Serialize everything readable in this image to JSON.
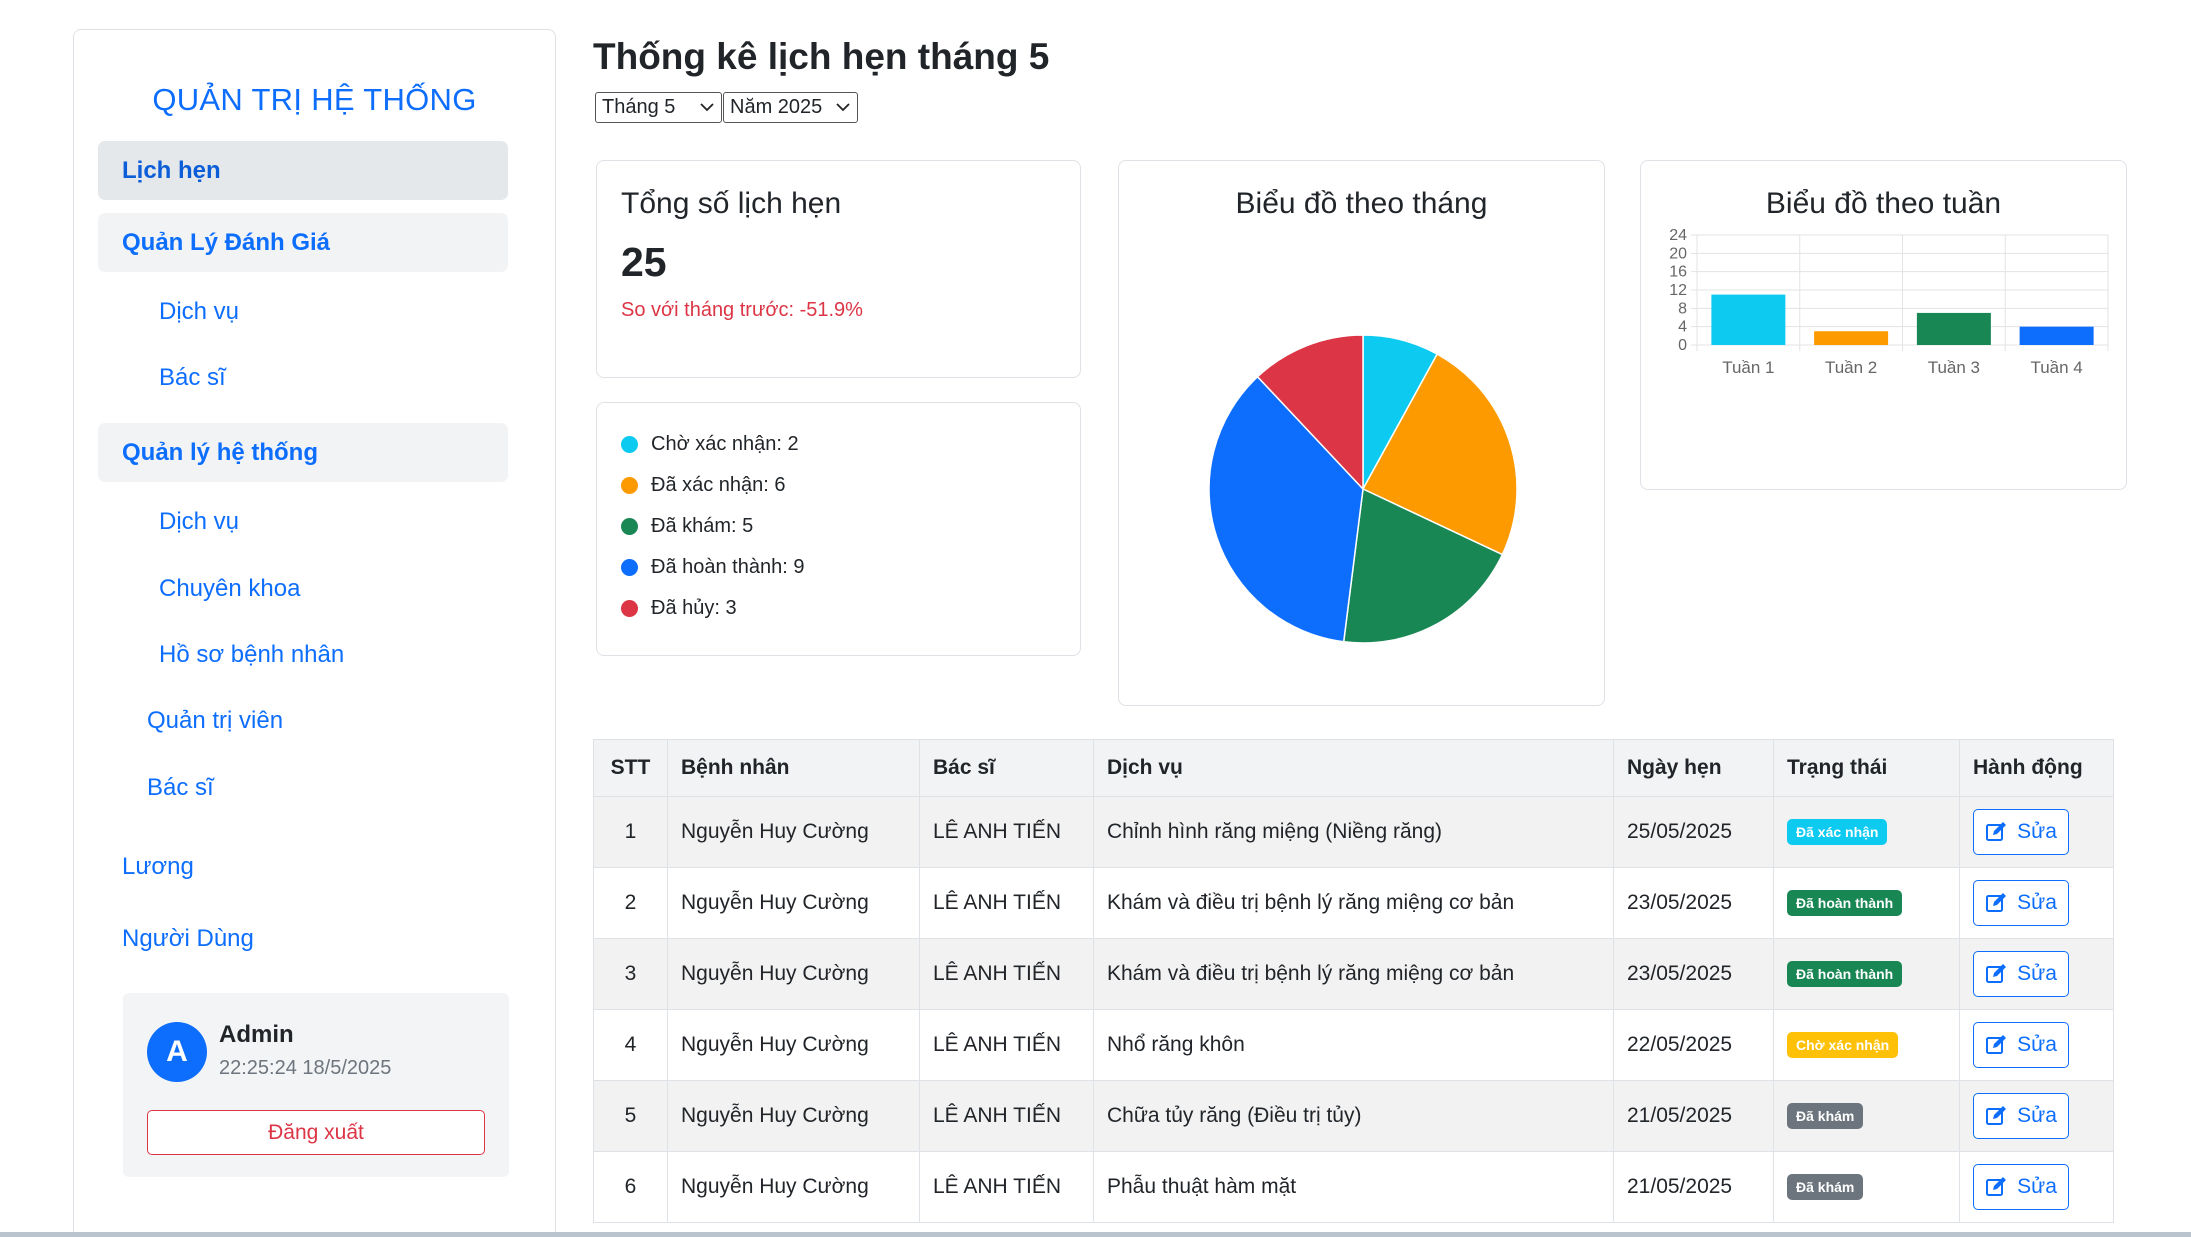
{
  "sidebar": {
    "title": "QUẢN TRỊ HỆ THỐNG",
    "appointments": "Lịch hẹn",
    "review_group": "Quản Lý Đánh Giá",
    "review_items": [
      "Dịch vụ",
      "Bác sĩ"
    ],
    "system_group": "Quản lý hệ thống",
    "system_items": [
      "Dịch vụ",
      "Chuyên khoa",
      "Hồ sơ bệnh nhân"
    ],
    "admin_link": "Quản trị viên",
    "doctor_link": "Bác sĩ",
    "salary": "Lương",
    "users": "Người Dùng"
  },
  "user": {
    "initial": "A",
    "name": "Admin",
    "time": "22:25:24 18/5/2025",
    "logout": "Đăng xuất"
  },
  "header": {
    "title": "Thống kê lịch hẹn tháng 5",
    "month": "Tháng 5",
    "year": "Năm 2025"
  },
  "summary": {
    "label": "Tổng số lịch hẹn",
    "total": "25",
    "compare": "So với tháng trước: -51.9%"
  },
  "status_legend": [
    {
      "text": "Chờ xác nhận: 2",
      "color": "#0dcaf0"
    },
    {
      "text": "Đã xác nhận: 6",
      "color": "#fd9a00"
    },
    {
      "text": "Đã khám: 5",
      "color": "#198754"
    },
    {
      "text": "Đã hoàn thành: 9",
      "color": "#0d6efd"
    },
    {
      "text": "Đã hủy: 3",
      "color": "#dc3545"
    }
  ],
  "charts": {
    "month_title": "Biểu đồ theo tháng",
    "week_title": "Biểu đồ theo tuần"
  },
  "chart_data": [
    {
      "type": "pie",
      "title": "Biểu đồ theo tháng",
      "categories": [
        "Chờ xác nhận",
        "Đã xác nhận",
        "Đã khám",
        "Đã hoàn thành",
        "Đã hủy"
      ],
      "values": [
        2,
        6,
        5,
        9,
        3
      ],
      "colors": [
        "#0dcaf0",
        "#fd9a00",
        "#198754",
        "#0d6efd",
        "#dc3545"
      ]
    },
    {
      "type": "bar",
      "title": "Biểu đồ theo tuần",
      "categories": [
        "Tuần 1",
        "Tuần 2",
        "Tuần 3",
        "Tuần 4"
      ],
      "values": [
        11,
        3,
        7,
        4
      ],
      "colors": [
        "#0dcaf0",
        "#fd9a00",
        "#198754",
        "#0d6efd"
      ],
      "ylim": [
        0,
        24
      ],
      "yticks": [
        0,
        4,
        8,
        12,
        16,
        20,
        24
      ],
      "grid": true
    }
  ],
  "table": {
    "headers": [
      "STT",
      "Bệnh nhân",
      "Bác sĩ",
      "Dịch vụ",
      "Ngày hẹn",
      "Trạng thái",
      "Hành động"
    ],
    "edit_label": "Sửa",
    "rows": [
      {
        "stt": "1",
        "patient": "Nguyễn Huy Cường",
        "doctor": "LÊ ANH TIẾN",
        "service": "Chỉnh hình răng miệng (Niềng răng)",
        "date": "25/05/2025",
        "status": "Đã xác nhận",
        "status_color": "#0dcaf0"
      },
      {
        "stt": "2",
        "patient": "Nguyễn Huy Cường",
        "doctor": "LÊ ANH TIẾN",
        "service": "Khám và điều trị bệnh lý răng miệng cơ bản",
        "date": "23/05/2025",
        "status": "Đã hoàn thành",
        "status_color": "#198754"
      },
      {
        "stt": "3",
        "patient": "Nguyễn Huy Cường",
        "doctor": "LÊ ANH TIẾN",
        "service": "Khám và điều trị bệnh lý răng miệng cơ bản",
        "date": "23/05/2025",
        "status": "Đã hoàn thành",
        "status_color": "#198754"
      },
      {
        "stt": "4",
        "patient": "Nguyễn Huy Cường",
        "doctor": "LÊ ANH TIẾN",
        "service": "Nhổ răng khôn",
        "date": "22/05/2025",
        "status": "Chờ xác nhận",
        "status_color": "#ffc107"
      },
      {
        "stt": "5",
        "patient": "Nguyễn Huy Cường",
        "doctor": "LÊ ANH TIẾN",
        "service": "Chữa tủy răng (Điều trị tủy)",
        "date": "21/05/2025",
        "status": "Đã khám",
        "status_color": "#6c757d"
      },
      {
        "stt": "6",
        "patient": "Nguyễn Huy Cường",
        "doctor": "LÊ ANH TIẾN",
        "service": "Phẫu thuật hàm mặt",
        "date": "21/05/2025",
        "status": "Đã khám",
        "status_color": "#6c757d"
      }
    ]
  }
}
